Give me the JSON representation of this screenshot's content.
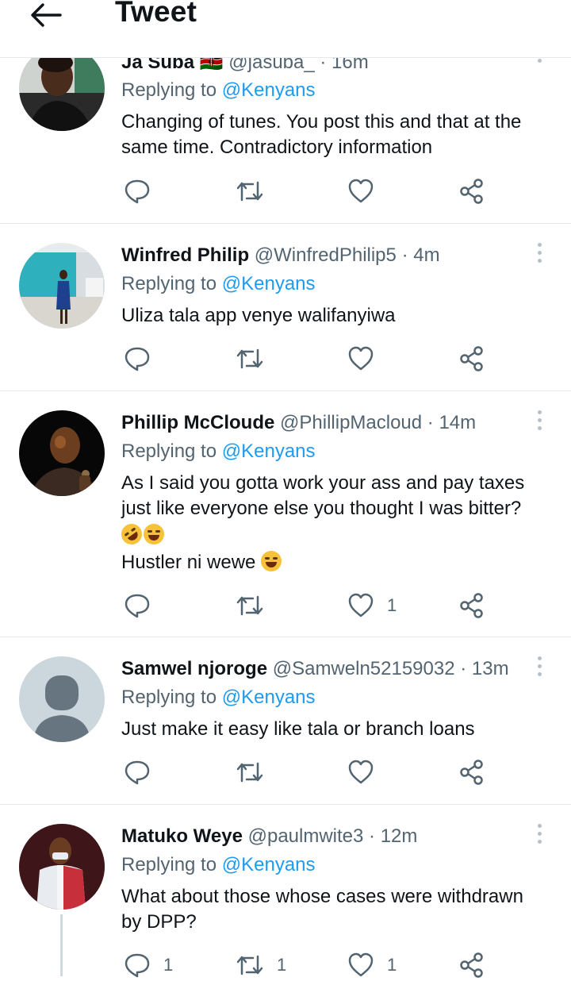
{
  "header": {
    "title": "Tweet"
  },
  "tweets": [
    {
      "name": "Ja Suba",
      "flag": "🇰🇪",
      "handle": "@jasuba_",
      "time": "· 16m",
      "replying_prefix": "Replying to",
      "replying_to": "@Kenyans",
      "lines": [
        "Changing of tunes. You post this and that at the",
        "same time. Contradictory information"
      ],
      "counts": {
        "reply": "",
        "retweet": "",
        "like": ""
      }
    },
    {
      "name": "Winfred Philip",
      "handle": "@WinfredPhilip5",
      "time": "· 4m",
      "replying_prefix": "Replying to",
      "replying_to": "@Kenyans",
      "lines": [
        "Uliza tala app venye walifanyiwa"
      ],
      "counts": {
        "reply": "",
        "retweet": "",
        "like": ""
      }
    },
    {
      "name": "Phillip McCloude",
      "handle": "@PhillipMacloud",
      "time": "· 14m",
      "replying_prefix": "Replying to",
      "replying_to": "@Kenyans",
      "lines": [
        "As I said you gotta work your ass and pay taxes",
        "just like everyone else you thought I was bitter?"
      ],
      "line4": "Hustler ni wewe",
      "emoji_names": [
        "rolling-on-floor-laughing-emoji",
        "tears-of-joy-emoji"
      ],
      "counts": {
        "reply": "",
        "retweet": "",
        "like": "1"
      }
    },
    {
      "name": "Samwel njoroge",
      "handle": "@Samweln52159032",
      "time": "· 13m",
      "replying_prefix": "Replying to",
      "replying_to": "@Kenyans",
      "lines": [
        "Just make it easy like tala or branch loans"
      ],
      "counts": {
        "reply": "",
        "retweet": "",
        "like": ""
      }
    },
    {
      "name": "Matuko Weye",
      "handle": "@paulmwite3",
      "time": "· 12m",
      "replying_prefix": "Replying to",
      "replying_to": "@Kenyans",
      "lines": [
        "What about those whose cases were withdrawn",
        "by DPP?"
      ],
      "counts": {
        "reply": "1",
        "retweet": "1",
        "like": "1"
      }
    }
  ],
  "icons": {
    "back": "arrow-left-icon",
    "reply": "reply-icon",
    "retweet": "retweet-icon",
    "like": "heart-icon",
    "share": "share-icon",
    "more": "more-vertical-icon"
  },
  "colors": {
    "accent": "#1d9bf0",
    "muted": "#536471",
    "text": "#0f1419"
  }
}
